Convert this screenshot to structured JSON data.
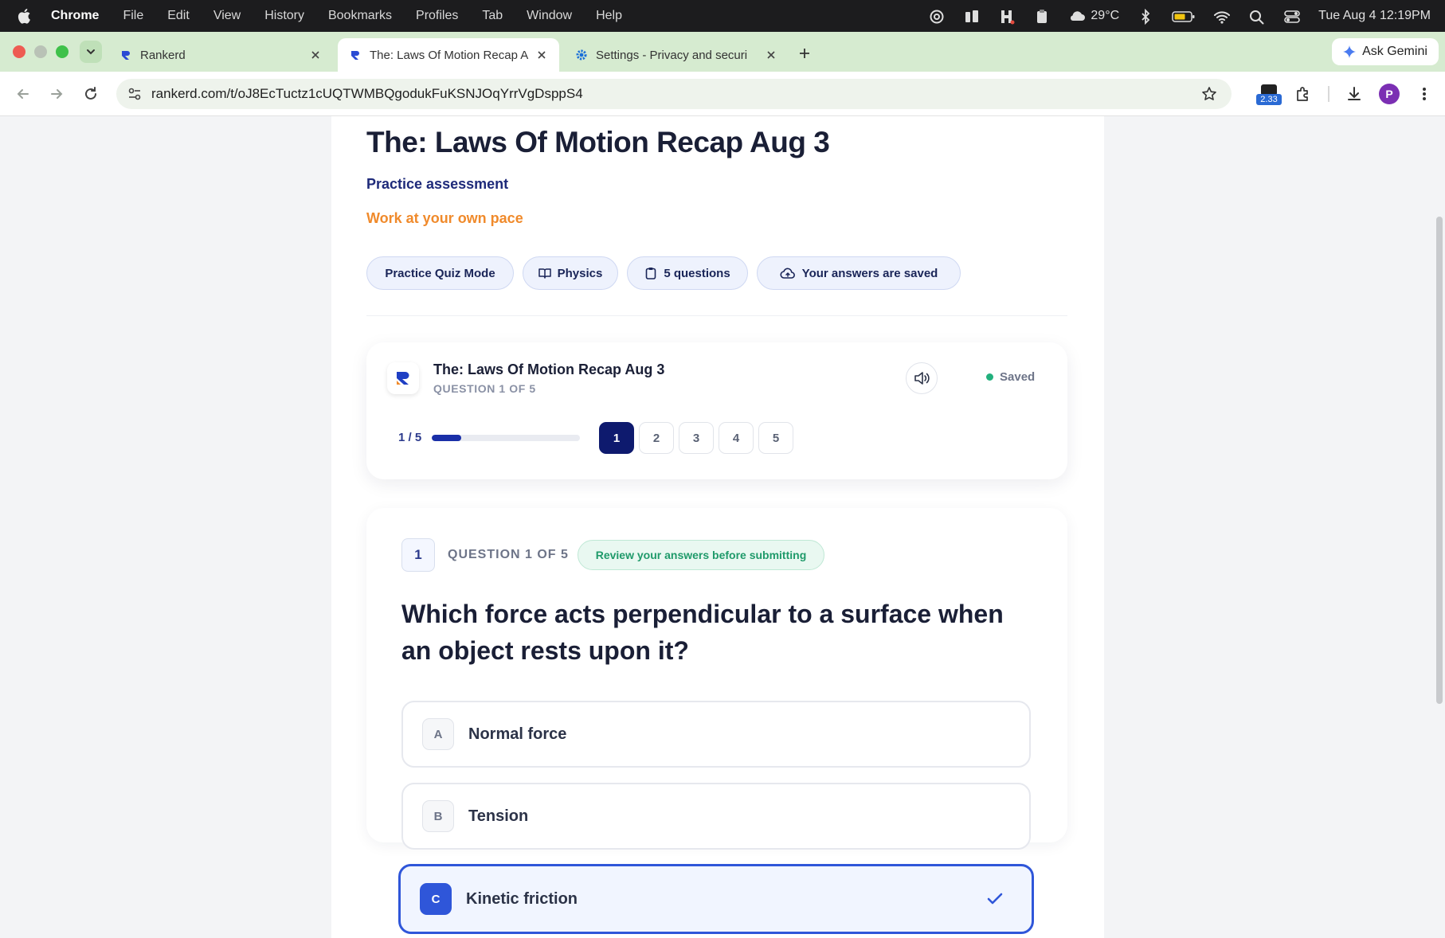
{
  "menubar": {
    "app_name": "Chrome",
    "menus": [
      "File",
      "Edit",
      "View",
      "History",
      "Bookmarks",
      "Profiles",
      "Tab",
      "Window",
      "Help"
    ],
    "weather": "29°C",
    "datetime": "Tue Aug 4  12:19PM"
  },
  "browser": {
    "tabs": [
      {
        "title": "Rankerd",
        "icon": "rankerd-favicon"
      },
      {
        "title": "The: Laws Of Motion Recap A",
        "icon": "rankerd-favicon"
      },
      {
        "title": "Settings - Privacy and securi",
        "icon": "gear-icon"
      }
    ],
    "ask_gemini": "Ask Gemini",
    "url": "rankerd.com/t/oJ8EcTuctz1cUQTWMBQgodukFuKSNJOqYrrVgDsppS4",
    "extension_badge": "2.33",
    "profile_initial": "P"
  },
  "page": {
    "title": "The: Laws Of Motion Recap Aug 3",
    "subtitle": "Practice assessment",
    "pace": "Work at your own pace",
    "chips": {
      "mode": "Practice Quiz Mode",
      "subject": "Physics",
      "questions": "5 questions",
      "saved": "Your answers are saved"
    },
    "quiz_card": {
      "title": "The: Laws Of Motion Recap Aug 3",
      "question_counter": "QUESTION 1 OF 5",
      "saved_label": "Saved",
      "progress_label": "1 / 5",
      "progress_fraction": 0.2,
      "question_numbers": [
        "1",
        "2",
        "3",
        "4",
        "5"
      ],
      "current_question": "1"
    },
    "question": {
      "number": "1",
      "counter": "QUESTION 1 OF 5",
      "review_note": "Review your answers before submitting",
      "text": "Which force acts perpendicular to a surface when an object rests upon it?",
      "options": [
        {
          "letter": "A",
          "text": "Normal force"
        },
        {
          "letter": "B",
          "text": "Tension"
        },
        {
          "letter": "C",
          "text": "Kinetic friction"
        }
      ],
      "selected": "C"
    }
  },
  "colors": {
    "accent": "#2f56d9",
    "navy": "#0e1a6e",
    "orange": "#f08a2b",
    "green": "#22b07d",
    "tab_strip": "#d6ebd0"
  }
}
